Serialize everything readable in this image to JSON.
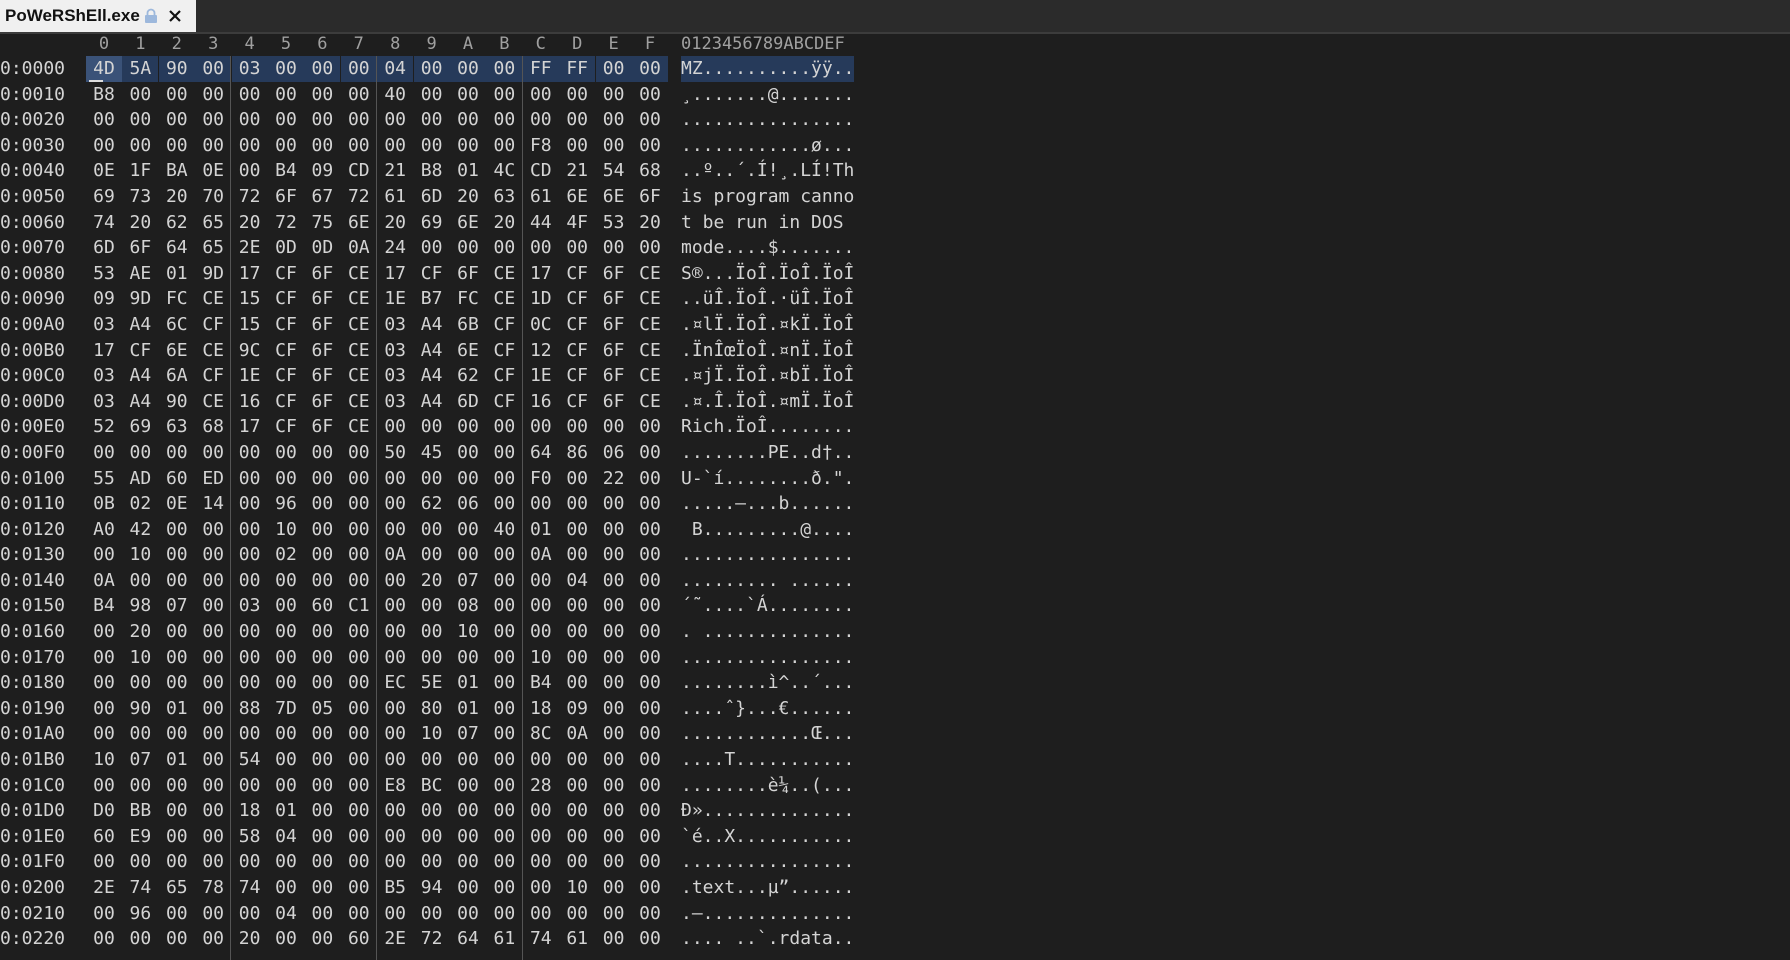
{
  "tab": {
    "title": "PoWeRShEll.exe"
  },
  "header": {
    "columns": [
      "0",
      "1",
      "2",
      "3",
      "4",
      "5",
      "6",
      "7",
      "8",
      "9",
      "A",
      "B",
      "C",
      "D",
      "E",
      "F"
    ],
    "ascii": "0123456789ABCDEF"
  },
  "rows": [
    {
      "offset": "0:0000",
      "bytes": [
        "4D",
        "5A",
        "90",
        "00",
        "03",
        "00",
        "00",
        "00",
        "04",
        "00",
        "00",
        "00",
        "FF",
        "FF",
        "00",
        "00"
      ],
      "ascii": "MZ..........ÿÿ.."
    },
    {
      "offset": "0:0010",
      "bytes": [
        "B8",
        "00",
        "00",
        "00",
        "00",
        "00",
        "00",
        "00",
        "40",
        "00",
        "00",
        "00",
        "00",
        "00",
        "00",
        "00"
      ],
      "ascii": "¸.......@......."
    },
    {
      "offset": "0:0020",
      "bytes": [
        "00",
        "00",
        "00",
        "00",
        "00",
        "00",
        "00",
        "00",
        "00",
        "00",
        "00",
        "00",
        "00",
        "00",
        "00",
        "00"
      ],
      "ascii": "................"
    },
    {
      "offset": "0:0030",
      "bytes": [
        "00",
        "00",
        "00",
        "00",
        "00",
        "00",
        "00",
        "00",
        "00",
        "00",
        "00",
        "00",
        "F8",
        "00",
        "00",
        "00"
      ],
      "ascii": "............ø..."
    },
    {
      "offset": "0:0040",
      "bytes": [
        "0E",
        "1F",
        "BA",
        "0E",
        "00",
        "B4",
        "09",
        "CD",
        "21",
        "B8",
        "01",
        "4C",
        "CD",
        "21",
        "54",
        "68"
      ],
      "ascii": "..º..´.Í!¸.LÍ!Th"
    },
    {
      "offset": "0:0050",
      "bytes": [
        "69",
        "73",
        "20",
        "70",
        "72",
        "6F",
        "67",
        "72",
        "61",
        "6D",
        "20",
        "63",
        "61",
        "6E",
        "6E",
        "6F"
      ],
      "ascii": "is program canno"
    },
    {
      "offset": "0:0060",
      "bytes": [
        "74",
        "20",
        "62",
        "65",
        "20",
        "72",
        "75",
        "6E",
        "20",
        "69",
        "6E",
        "20",
        "44",
        "4F",
        "53",
        "20"
      ],
      "ascii": "t be run in DOS "
    },
    {
      "offset": "0:0070",
      "bytes": [
        "6D",
        "6F",
        "64",
        "65",
        "2E",
        "0D",
        "0D",
        "0A",
        "24",
        "00",
        "00",
        "00",
        "00",
        "00",
        "00",
        "00"
      ],
      "ascii": "mode....$......."
    },
    {
      "offset": "0:0080",
      "bytes": [
        "53",
        "AE",
        "01",
        "9D",
        "17",
        "CF",
        "6F",
        "CE",
        "17",
        "CF",
        "6F",
        "CE",
        "17",
        "CF",
        "6F",
        "CE"
      ],
      "ascii": "S®...ÏoÎ.ÏoÎ.ÏoÎ"
    },
    {
      "offset": "0:0090",
      "bytes": [
        "09",
        "9D",
        "FC",
        "CE",
        "15",
        "CF",
        "6F",
        "CE",
        "1E",
        "B7",
        "FC",
        "CE",
        "1D",
        "CF",
        "6F",
        "CE"
      ],
      "ascii": "..üÎ.ÏoÎ.·üÎ.ÏoÎ"
    },
    {
      "offset": "0:00A0",
      "bytes": [
        "03",
        "A4",
        "6C",
        "CF",
        "15",
        "CF",
        "6F",
        "CE",
        "03",
        "A4",
        "6B",
        "CF",
        "0C",
        "CF",
        "6F",
        "CE"
      ],
      "ascii": ".¤lÏ.ÏoÎ.¤kÏ.ÏoÎ"
    },
    {
      "offset": "0:00B0",
      "bytes": [
        "17",
        "CF",
        "6E",
        "CE",
        "9C",
        "CF",
        "6F",
        "CE",
        "03",
        "A4",
        "6E",
        "CF",
        "12",
        "CF",
        "6F",
        "CE"
      ],
      "ascii": ".ÏnÎœÏoÎ.¤nÏ.ÏoÎ"
    },
    {
      "offset": "0:00C0",
      "bytes": [
        "03",
        "A4",
        "6A",
        "CF",
        "1E",
        "CF",
        "6F",
        "CE",
        "03",
        "A4",
        "62",
        "CF",
        "1E",
        "CF",
        "6F",
        "CE"
      ],
      "ascii": ".¤jÏ.ÏoÎ.¤bÏ.ÏoÎ"
    },
    {
      "offset": "0:00D0",
      "bytes": [
        "03",
        "A4",
        "90",
        "CE",
        "16",
        "CF",
        "6F",
        "CE",
        "03",
        "A4",
        "6D",
        "CF",
        "16",
        "CF",
        "6F",
        "CE"
      ],
      "ascii": ".¤.Î.ÏoÎ.¤mÏ.ÏoÎ"
    },
    {
      "offset": "0:00E0",
      "bytes": [
        "52",
        "69",
        "63",
        "68",
        "17",
        "CF",
        "6F",
        "CE",
        "00",
        "00",
        "00",
        "00",
        "00",
        "00",
        "00",
        "00"
      ],
      "ascii": "Rich.ÏoÎ........"
    },
    {
      "offset": "0:00F0",
      "bytes": [
        "00",
        "00",
        "00",
        "00",
        "00",
        "00",
        "00",
        "00",
        "50",
        "45",
        "00",
        "00",
        "64",
        "86",
        "06",
        "00"
      ],
      "ascii": "........PE..d†.."
    },
    {
      "offset": "0:0100",
      "bytes": [
        "55",
        "AD",
        "60",
        "ED",
        "00",
        "00",
        "00",
        "00",
        "00",
        "00",
        "00",
        "00",
        "F0",
        "00",
        "22",
        "00"
      ],
      "ascii": "U-`í........ð.\"."
    },
    {
      "offset": "0:0110",
      "bytes": [
        "0B",
        "02",
        "0E",
        "14",
        "00",
        "96",
        "00",
        "00",
        "00",
        "62",
        "06",
        "00",
        "00",
        "00",
        "00",
        "00"
      ],
      "ascii": ".....–...b......"
    },
    {
      "offset": "0:0120",
      "bytes": [
        "A0",
        "42",
        "00",
        "00",
        "00",
        "10",
        "00",
        "00",
        "00",
        "00",
        "00",
        "40",
        "01",
        "00",
        "00",
        "00"
      ],
      "ascii": " B.........@...."
    },
    {
      "offset": "0:0130",
      "bytes": [
        "00",
        "10",
        "00",
        "00",
        "00",
        "02",
        "00",
        "00",
        "0A",
        "00",
        "00",
        "00",
        "0A",
        "00",
        "00",
        "00"
      ],
      "ascii": "................"
    },
    {
      "offset": "0:0140",
      "bytes": [
        "0A",
        "00",
        "00",
        "00",
        "00",
        "00",
        "00",
        "00",
        "00",
        "20",
        "07",
        "00",
        "00",
        "04",
        "00",
        "00"
      ],
      "ascii": "......... ......"
    },
    {
      "offset": "0:0150",
      "bytes": [
        "B4",
        "98",
        "07",
        "00",
        "03",
        "00",
        "60",
        "C1",
        "00",
        "00",
        "08",
        "00",
        "00",
        "00",
        "00",
        "00"
      ],
      "ascii": "´˜....`Á........"
    },
    {
      "offset": "0:0160",
      "bytes": [
        "00",
        "20",
        "00",
        "00",
        "00",
        "00",
        "00",
        "00",
        "00",
        "00",
        "10",
        "00",
        "00",
        "00",
        "00",
        "00"
      ],
      "ascii": ". .............."
    },
    {
      "offset": "0:0170",
      "bytes": [
        "00",
        "10",
        "00",
        "00",
        "00",
        "00",
        "00",
        "00",
        "00",
        "00",
        "00",
        "00",
        "10",
        "00",
        "00",
        "00"
      ],
      "ascii": "................"
    },
    {
      "offset": "0:0180",
      "bytes": [
        "00",
        "00",
        "00",
        "00",
        "00",
        "00",
        "00",
        "00",
        "EC",
        "5E",
        "01",
        "00",
        "B4",
        "00",
        "00",
        "00"
      ],
      "ascii": "........ì^..´..."
    },
    {
      "offset": "0:0190",
      "bytes": [
        "00",
        "90",
        "01",
        "00",
        "88",
        "7D",
        "05",
        "00",
        "00",
        "80",
        "01",
        "00",
        "18",
        "09",
        "00",
        "00"
      ],
      "ascii": "....ˆ}...€......"
    },
    {
      "offset": "0:01A0",
      "bytes": [
        "00",
        "00",
        "00",
        "00",
        "00",
        "00",
        "00",
        "00",
        "00",
        "10",
        "07",
        "00",
        "8C",
        "0A",
        "00",
        "00"
      ],
      "ascii": "............Œ..."
    },
    {
      "offset": "0:01B0",
      "bytes": [
        "10",
        "07",
        "01",
        "00",
        "54",
        "00",
        "00",
        "00",
        "00",
        "00",
        "00",
        "00",
        "00",
        "00",
        "00",
        "00"
      ],
      "ascii": "....T..........."
    },
    {
      "offset": "0:01C0",
      "bytes": [
        "00",
        "00",
        "00",
        "00",
        "00",
        "00",
        "00",
        "00",
        "E8",
        "BC",
        "00",
        "00",
        "28",
        "00",
        "00",
        "00"
      ],
      "ascii": "........è¼..(..."
    },
    {
      "offset": "0:01D0",
      "bytes": [
        "D0",
        "BB",
        "00",
        "00",
        "18",
        "01",
        "00",
        "00",
        "00",
        "00",
        "00",
        "00",
        "00",
        "00",
        "00",
        "00"
      ],
      "ascii": "Ð».............."
    },
    {
      "offset": "0:01E0",
      "bytes": [
        "60",
        "E9",
        "00",
        "00",
        "58",
        "04",
        "00",
        "00",
        "00",
        "00",
        "00",
        "00",
        "00",
        "00",
        "00",
        "00"
      ],
      "ascii": "`é..X..........."
    },
    {
      "offset": "0:01F0",
      "bytes": [
        "00",
        "00",
        "00",
        "00",
        "00",
        "00",
        "00",
        "00",
        "00",
        "00",
        "00",
        "00",
        "00",
        "00",
        "00",
        "00"
      ],
      "ascii": "................"
    },
    {
      "offset": "0:0200",
      "bytes": [
        "2E",
        "74",
        "65",
        "78",
        "74",
        "00",
        "00",
        "00",
        "B5",
        "94",
        "00",
        "00",
        "00",
        "10",
        "00",
        "00"
      ],
      "ascii": ".text...µ”......"
    },
    {
      "offset": "0:0210",
      "bytes": [
        "00",
        "96",
        "00",
        "00",
        "00",
        "04",
        "00",
        "00",
        "00",
        "00",
        "00",
        "00",
        "00",
        "00",
        "00",
        "00"
      ],
      "ascii": ".–.............."
    },
    {
      "offset": "0:0220",
      "bytes": [
        "00",
        "00",
        "00",
        "00",
        "20",
        "00",
        "00",
        "60",
        "2E",
        "72",
        "64",
        "61",
        "74",
        "61",
        "00",
        "00"
      ],
      "ascii": ".... ..`.rdata.."
    }
  ],
  "colors": {
    "background": "#1e1e1e",
    "text": "#d4d4d4",
    "selection": "#263a5a"
  },
  "icons": {
    "tab_lock": "lock-icon",
    "tab_close": "close-icon"
  }
}
